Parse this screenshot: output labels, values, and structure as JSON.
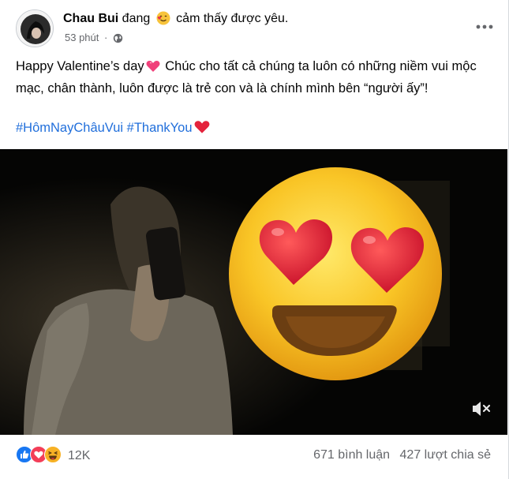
{
  "post": {
    "author": "Chau Bui",
    "feeling_prefix": "đang",
    "feeling_emoji": "smiling-face-with-hearts-icon",
    "feeling_text": "cảm thấy được yêu.",
    "time": "53 phút",
    "separator": "·",
    "privacy_icon": "globe-icon"
  },
  "content": {
    "text_part1": "Happy Valentine’s day",
    "text_part2": " Chúc cho tất cả chúng ta luôn có những niềm vui mộc mạc, chân thành, luôn được là trẻ con và là chính mình bên “người ấy”!",
    "hashtags": [
      "#HômNayChâuVui",
      "#ThankYou"
    ]
  },
  "footer": {
    "reaction_icons": [
      "like-icon",
      "love-icon",
      "haha-icon"
    ],
    "reaction_count": "12K",
    "comments": "671 bình luận",
    "shares": "427 lượt chia sẻ"
  },
  "colors": {
    "hashtag": "#216fdb",
    "secondary_text": "#65676b",
    "like_blue": "#1877f2",
    "love_red": "#f33e58",
    "haha_yellow": "#f7b125"
  }
}
